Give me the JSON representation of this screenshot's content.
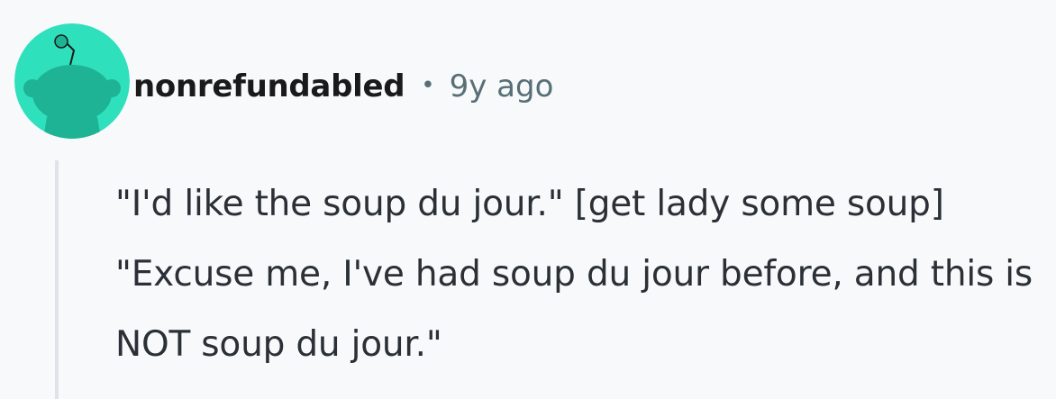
{
  "comment": {
    "author": "nonrefundabled",
    "separator": "•",
    "timestamp": "9y ago",
    "body": "\"I'd like the soup du jour.\" [get lady some soup] \"Excuse me, I've had soup du jour before, and this is NOT soup du jour.\"",
    "avatar_icon": "snoo-avatar-icon"
  },
  "colors": {
    "avatar_bg": "#2fe0bd",
    "avatar_figure": "#1db394",
    "username": "#1a1a1b",
    "meta": "#576f76",
    "thread_line": "#dfe3e8",
    "background": "#f8f9fb"
  }
}
